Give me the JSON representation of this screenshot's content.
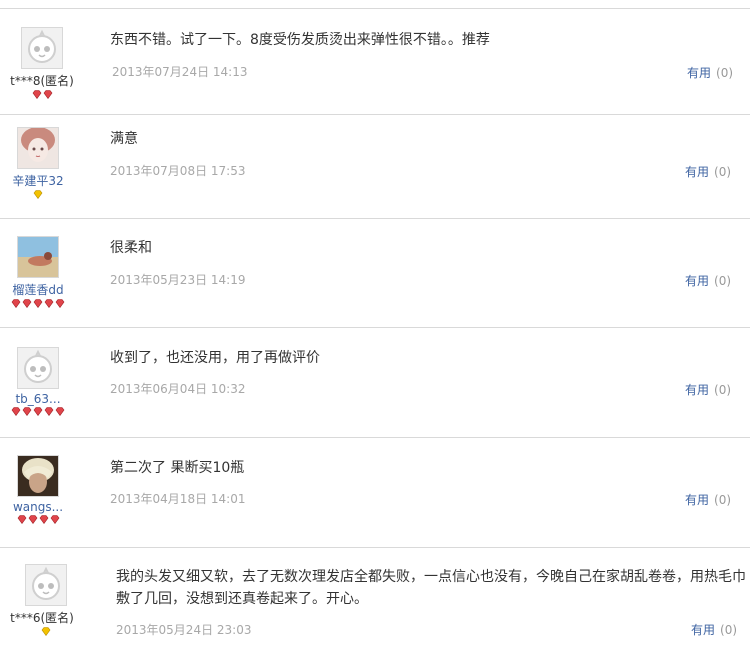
{
  "reviews": [
    {
      "user": "t***8(匿名)",
      "avatar": "default-avatar-icon",
      "text": "东西不错。试了一下。8度受伤发质烫出来弹性很不错。。推荐",
      "date": "2013年07月24日 14:13",
      "useful_label": "有用",
      "useful_count": "(0)"
    },
    {
      "user": "辛建平32",
      "avatar": "photo-avatar-girl",
      "text": "满意",
      "date": "2013年07月08日 17:53",
      "useful_label": "有用",
      "useful_count": "(0)"
    },
    {
      "user": "榴莲香dd",
      "avatar": "photo-avatar-beach",
      "text": "很柔和",
      "date": "2013年05月23日 14:19",
      "useful_label": "有用",
      "useful_count": "(0)"
    },
    {
      "user": "tb_63...",
      "avatar": "default-avatar-icon",
      "text": "收到了，也还没用，用了再做评价",
      "date": "2013年06月04日 10:32",
      "useful_label": "有用",
      "useful_count": "(0)"
    },
    {
      "user": "wangs...",
      "avatar": "photo-avatar-blond",
      "text": "第二次了 果断买10瓶",
      "date": "2013年04月18日 14:01",
      "useful_label": "有用",
      "useful_count": "(0)"
    },
    {
      "user": "t***6(匿名)",
      "avatar": "default-avatar-icon",
      "text": "我的头发又细又软，去了无数次理发店全都失败，一点信心也没有，今晚自己在家胡乱卷卷，用热毛巾敷了几回，没想到还真卷起来了。开心。",
      "date": "2013年05月24日 23:03",
      "useful_label": "有用",
      "useful_count": "(0)"
    }
  ],
  "colors": {
    "link": "#3e63a2",
    "date": "#a8a8a8",
    "red_gem": "#e0444a",
    "yellow_gem": "#f3c200"
  }
}
